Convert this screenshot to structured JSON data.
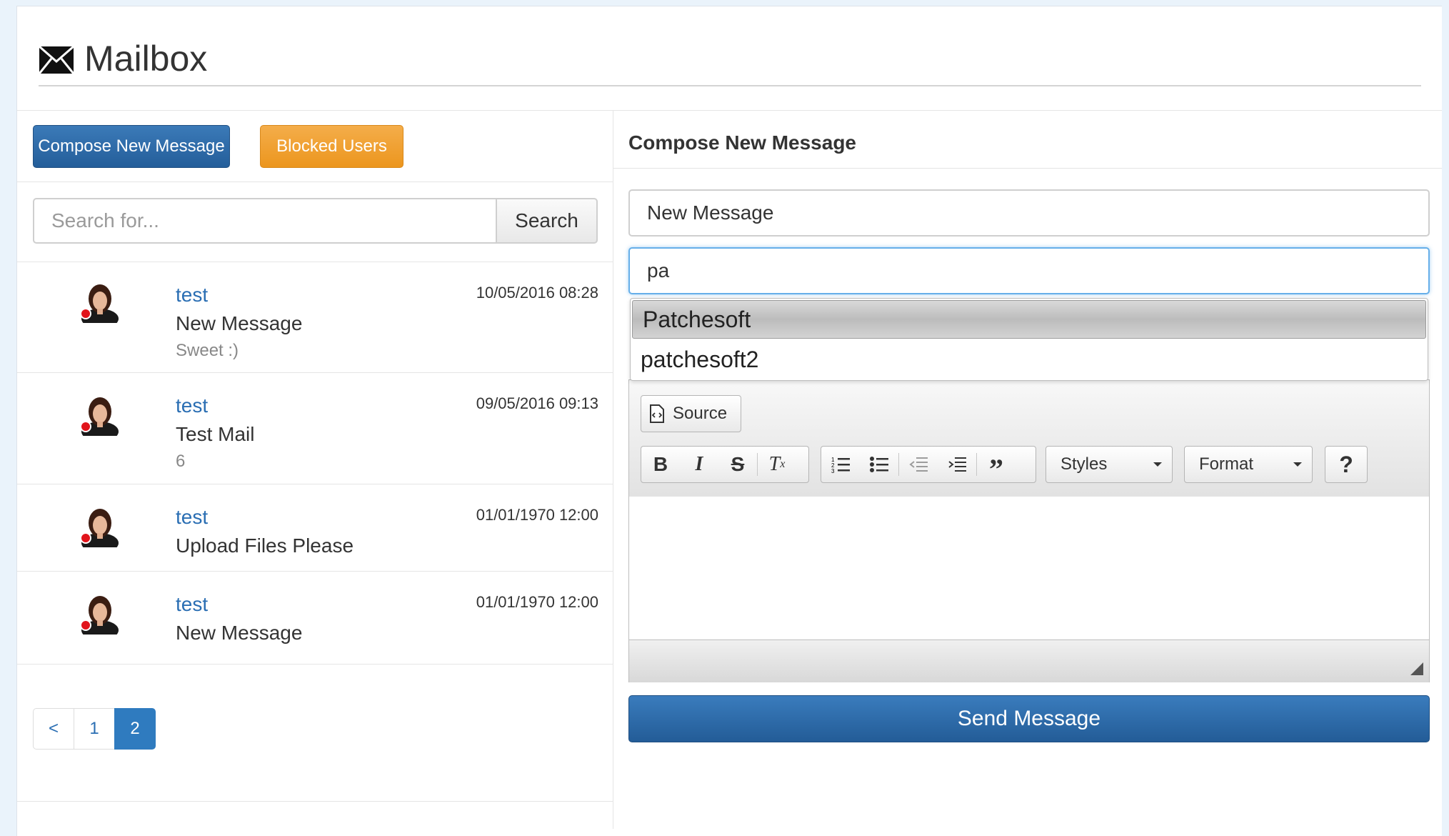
{
  "header": {
    "title": "Mailbox",
    "icon": "envelope-icon"
  },
  "left": {
    "compose_label": "Compose New Message",
    "blocked_label": "Blocked Users",
    "search": {
      "placeholder": "Search for...",
      "button_label": "Search"
    },
    "messages": [
      {
        "from": "test",
        "subject": "New Message",
        "preview": "Sweet :)",
        "date": "10/05/2016 08:28",
        "status": "unread"
      },
      {
        "from": "test",
        "subject": "Test Mail",
        "preview": "6",
        "date": "09/05/2016 09:13",
        "status": "unread"
      },
      {
        "from": "test",
        "subject": "Upload Files Please",
        "preview": "",
        "date": "01/01/1970 12:00",
        "status": "unread"
      },
      {
        "from": "test",
        "subject": "New Message",
        "preview": "",
        "date": "01/01/1970 12:00",
        "status": "unread"
      }
    ],
    "pagination": {
      "prev": "<",
      "pages": [
        "1",
        "2"
      ],
      "current": "2"
    }
  },
  "right": {
    "title": "Compose New Message",
    "subject_value": "New Message",
    "recipient_value": "pa",
    "autocomplete": [
      "Patchesoft",
      "patchesoft2"
    ],
    "editor": {
      "source_label": "Source",
      "styles_label": "Styles",
      "format_label": "Format",
      "help_label": "?"
    },
    "send_label": "Send Message"
  },
  "colors": {
    "primary": "#2a6eb3",
    "warning": "#ec961e",
    "unread_dot": "#e1141b",
    "background": "#eaf3fb"
  }
}
